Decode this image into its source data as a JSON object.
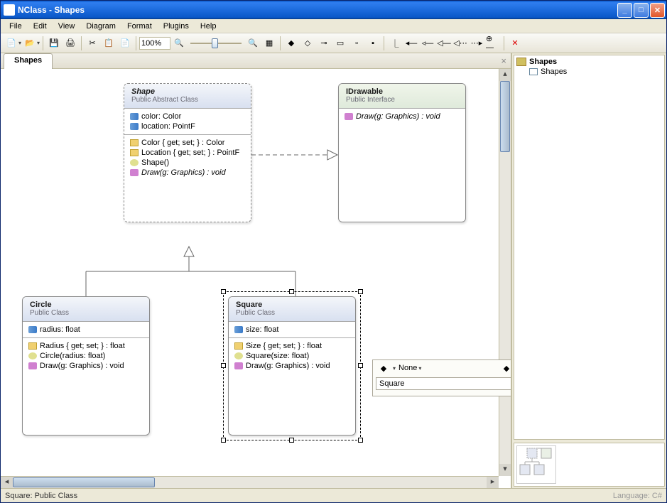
{
  "window": {
    "title": "NClass - Shapes"
  },
  "menu": {
    "items": [
      "File",
      "Edit",
      "View",
      "Diagram",
      "Format",
      "Plugins",
      "Help"
    ]
  },
  "toolbar": {
    "zoom": "100%"
  },
  "tabs": {
    "active": "Shapes"
  },
  "classes": {
    "shape": {
      "name": "Shape",
      "stereo": "Public Abstract Class",
      "fields": [
        {
          "text": "color: Color"
        },
        {
          "text": "location: PointF"
        }
      ],
      "members": [
        {
          "kind": "prop",
          "text": "Color { get; set; } : Color"
        },
        {
          "kind": "prop",
          "text": "Location { get; set; } : PointF"
        },
        {
          "kind": "ctor",
          "text": "Shape()"
        },
        {
          "kind": "method",
          "text": "Draw(g: Graphics) : void",
          "abs": true
        }
      ]
    },
    "idrawable": {
      "name": "IDrawable",
      "stereo": "Public Interface",
      "members": [
        {
          "kind": "method",
          "text": "Draw(g: Graphics) : void",
          "abs": true
        }
      ]
    },
    "circle": {
      "name": "Circle",
      "stereo": "Public Class",
      "fields": [
        {
          "text": "radius: float"
        }
      ],
      "members": [
        {
          "kind": "prop",
          "text": "Radius { get; set; } : float"
        },
        {
          "kind": "ctor",
          "text": "Circle(radius: float)"
        },
        {
          "kind": "method",
          "text": "Draw(g: Graphics) : void"
        }
      ]
    },
    "square": {
      "name": "Square",
      "stereo": "Public Class",
      "fields": [
        {
          "text": "size: float"
        }
      ],
      "members": [
        {
          "kind": "prop",
          "text": "Size { get; set; } : float"
        },
        {
          "kind": "ctor",
          "text": "Square(size: float)"
        },
        {
          "kind": "method",
          "text": "Draw(g: Graphics) : void"
        }
      ]
    }
  },
  "floatbar": {
    "access": "None",
    "input": "Square"
  },
  "tree": {
    "project": "Shapes",
    "diagram": "Shapes"
  },
  "status": {
    "left": "Square: Public Class",
    "right": "Language: C#"
  }
}
